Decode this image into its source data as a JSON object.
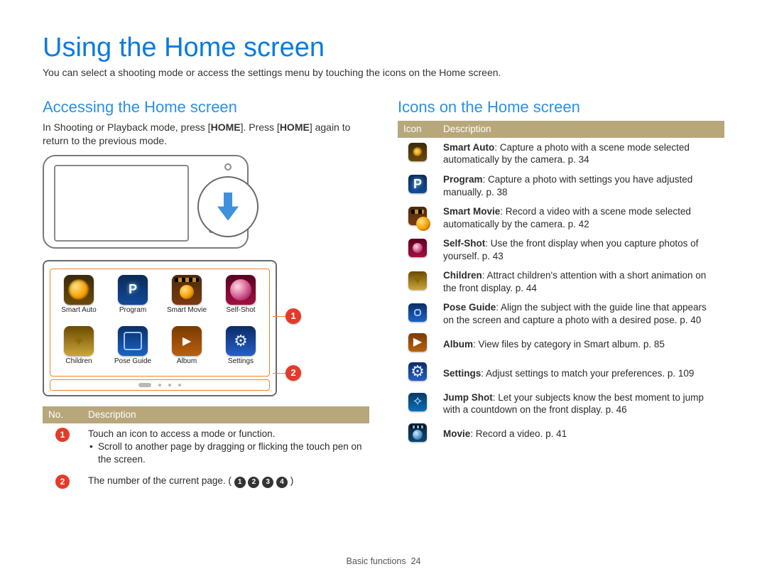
{
  "title": "Using the Home screen",
  "lead": "You can select a shooting mode or access the settings menu by touching the icons on the Home screen.",
  "left": {
    "heading": "Accessing the Home screen",
    "intro_pre": "In Shooting or Playback mode, press [",
    "intro_home1": "HOME",
    "intro_mid": "]. Press [",
    "intro_home2": "HOME",
    "intro_post": "] again to return to the previous mode.",
    "apps": [
      {
        "label": "Smart Auto",
        "icon": "ic-smart"
      },
      {
        "label": "Program",
        "icon": "ic-prog"
      },
      {
        "label": "Smart Movie",
        "icon": "ic-smovie"
      },
      {
        "label": "Self-Shot",
        "icon": "ic-self"
      },
      {
        "label": "Children",
        "icon": "ic-child"
      },
      {
        "label": "Pose Guide",
        "icon": "ic-pose"
      },
      {
        "label": "Album",
        "icon": "ic-album"
      },
      {
        "label": "Settings",
        "icon": "ic-settings"
      }
    ],
    "table": {
      "head_no": "No.",
      "head_desc": "Description",
      "rows": [
        {
          "num": "1",
          "line1": "Touch an icon to access a mode or function.",
          "bullet": "Scroll to another page by dragging or flicking the touch pen on the screen."
        },
        {
          "num": "2",
          "text_pre": "The number of the current page. (",
          "d1": "1",
          "d2": "2",
          "d3": "3",
          "d4": "4",
          "text_post": ")"
        }
      ]
    }
  },
  "right": {
    "heading": "Icons on the Home screen",
    "head_icon": "Icon",
    "head_desc": "Description",
    "rows": [
      {
        "icon": "ic-smart",
        "name": "Smart Auto",
        "desc": ": Capture a photo with a scene mode selected automatically by the camera. p. 34"
      },
      {
        "icon": "ic-prog",
        "name": "Program",
        "desc": ": Capture a photo with settings you have adjusted manually. p. 38"
      },
      {
        "icon": "ic-smovie",
        "name": "Smart Movie",
        "desc": ": Record a video with a scene mode selected automatically by the camera. p. 42"
      },
      {
        "icon": "ic-self",
        "name": "Self-Shot",
        "desc": ": Use the front display when you capture photos of yourself. p. 43"
      },
      {
        "icon": "ic-child",
        "name": "Children",
        "desc": ": Attract children's attention with a short animation on the front display. p. 44"
      },
      {
        "icon": "ic-pose",
        "name": "Pose Guide",
        "desc": ": Align the subject with the guide line that appears on the screen and capture a photo with a desired pose. p. 40"
      },
      {
        "icon": "ic-album",
        "name": "Album",
        "desc": ": View files by category in Smart album. p. 85"
      },
      {
        "icon": "ic-settings",
        "name": "Settings",
        "desc": ": Adjust settings to match your preferences. p. 109"
      },
      {
        "icon": "ic-jump",
        "name": "Jump Shot",
        "desc": ": Let your subjects know the best moment to jump with a countdown on the front display. p. 46"
      },
      {
        "icon": "ic-movie",
        "name": "Movie",
        "desc": ": Record a video. p. 41"
      }
    ]
  },
  "footer": {
    "section": "Basic functions",
    "page": "24"
  }
}
